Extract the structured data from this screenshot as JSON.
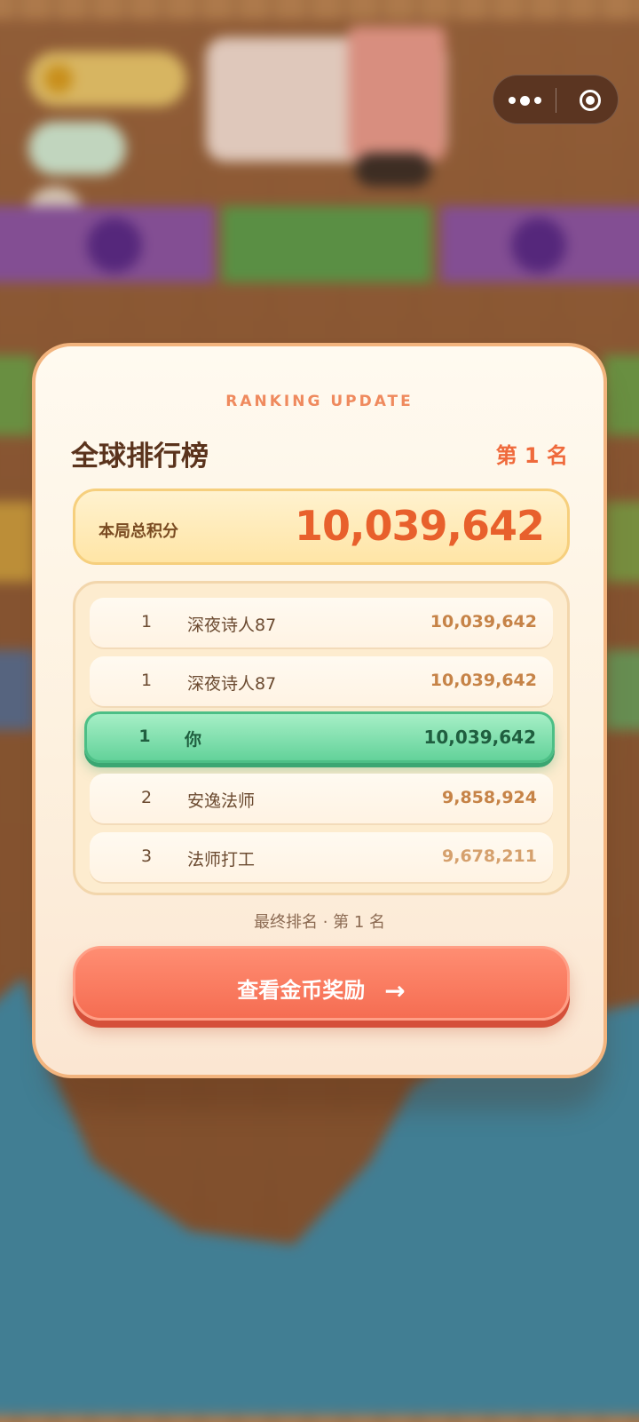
{
  "capsule": {
    "more_icon": "more-dots-icon",
    "close_icon": "target-circle-icon"
  },
  "modal": {
    "overline": "RANKING UPDATE",
    "title": "全球排行榜",
    "rank_badge": "第 1 名",
    "score": {
      "label": "本局总积分",
      "value": "10,039,642"
    },
    "rows": [
      {
        "rank": "1",
        "name": "深夜诗人87",
        "points": "10,039,642"
      },
      {
        "rank": "1",
        "name": "深夜诗人87",
        "points": "10,039,642"
      },
      {
        "rank": "1",
        "name": "你",
        "points": "10,039,642",
        "is_me": true
      },
      {
        "rank": "2",
        "name": "安逸法师",
        "points": "9,858,924"
      },
      {
        "rank": "3",
        "name": "法师打工",
        "points": "9,678,211"
      }
    ],
    "final_rank": "最终排名 · 第 1 名",
    "cta": {
      "label": "查看金币奖励",
      "arrow": "→"
    }
  },
  "colors": {
    "accent": "#ef6a3c",
    "cta": "#f56d52",
    "me_row": "#63d29a",
    "border": "#f2b47e"
  }
}
